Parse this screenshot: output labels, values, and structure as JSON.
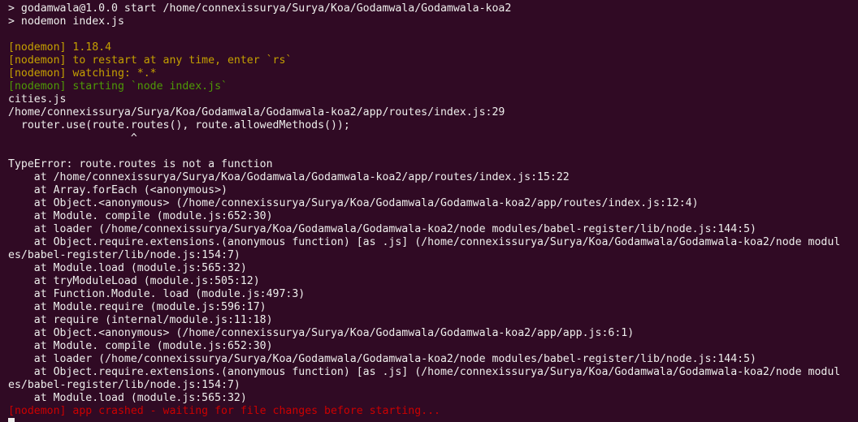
{
  "terminal": {
    "lines": [
      {
        "text": "> godamwala@1.0.0 start /home/connexissurya/Surya/Koa/Godamwala/Godamwala-koa2",
        "color": "white"
      },
      {
        "text": "> nodemon index.js",
        "color": "white"
      },
      {
        "text": "",
        "color": "white"
      },
      {
        "text": "[nodemon] 1.18.4",
        "color": "yellow"
      },
      {
        "text": "[nodemon] to restart at any time, enter `rs`",
        "color": "yellow"
      },
      {
        "text": "[nodemon] watching: *.*",
        "color": "yellow"
      },
      {
        "text": "[nodemon] starting `node index.js`",
        "color": "green"
      },
      {
        "text": "cities.js",
        "color": "white"
      },
      {
        "text": "/home/connexissurya/Surya/Koa/Godamwala/Godamwala-koa2/app/routes/index.js:29",
        "color": "white"
      },
      {
        "text": "  router.use(route.routes(), route.allowedMethods());",
        "color": "white"
      },
      {
        "text": "                   ^",
        "color": "white"
      },
      {
        "text": "",
        "color": "white"
      },
      {
        "text": "TypeError: route.routes is not a function",
        "color": "white"
      },
      {
        "text": "    at /home/connexissurya/Surya/Koa/Godamwala/Godamwala-koa2/app/routes/index.js:15:22",
        "color": "white"
      },
      {
        "text": "    at Array.forEach (<anonymous>)",
        "color": "white"
      },
      {
        "text": "    at Object.<anonymous> (/home/connexissurya/Surya/Koa/Godamwala/Godamwala-koa2/app/routes/index.js:12:4)",
        "color": "white"
      },
      {
        "text": "    at Module. compile (module.js:652:30)",
        "color": "white"
      },
      {
        "text": "    at loader (/home/connexissurya/Surya/Koa/Godamwala/Godamwala-koa2/node modules/babel-register/lib/node.js:144:5)",
        "color": "white"
      },
      {
        "text": "    at Object.require.extensions.(anonymous function) [as .js] (/home/connexissurya/Surya/Koa/Godamwala/Godamwala-koa2/node modul",
        "color": "white"
      },
      {
        "text": "es/babel-register/lib/node.js:154:7)",
        "color": "white"
      },
      {
        "text": "    at Module.load (module.js:565:32)",
        "color": "white"
      },
      {
        "text": "    at tryModuleLoad (module.js:505:12)",
        "color": "white"
      },
      {
        "text": "    at Function.Module. load (module.js:497:3)",
        "color": "white"
      },
      {
        "text": "    at Module.require (module.js:596:17)",
        "color": "white"
      },
      {
        "text": "    at require (internal/module.js:11:18)",
        "color": "white"
      },
      {
        "text": "    at Object.<anonymous> (/home/connexissurya/Surya/Koa/Godamwala/Godamwala-koa2/app/app.js:6:1)",
        "color": "white"
      },
      {
        "text": "    at Module. compile (module.js:652:30)",
        "color": "white"
      },
      {
        "text": "    at loader (/home/connexissurya/Surya/Koa/Godamwala/Godamwala-koa2/node modules/babel-register/lib/node.js:144:5)",
        "color": "white"
      },
      {
        "text": "    at Object.require.extensions.(anonymous function) [as .js] (/home/connexissurya/Surya/Koa/Godamwala/Godamwala-koa2/node modul",
        "color": "white"
      },
      {
        "text": "es/babel-register/lib/node.js:154:7)",
        "color": "white"
      },
      {
        "text": "    at Module.load (module.js:565:32)",
        "color": "white"
      },
      {
        "text": "[nodemon] app crashed - waiting for file changes before starting...",
        "color": "red"
      }
    ]
  },
  "colors": {
    "background": "#300a24",
    "text": "#eeeeec",
    "nodemon_yellow": "#c4a000",
    "nodemon_green": "#4e9a06",
    "nodemon_red": "#cc0000"
  }
}
